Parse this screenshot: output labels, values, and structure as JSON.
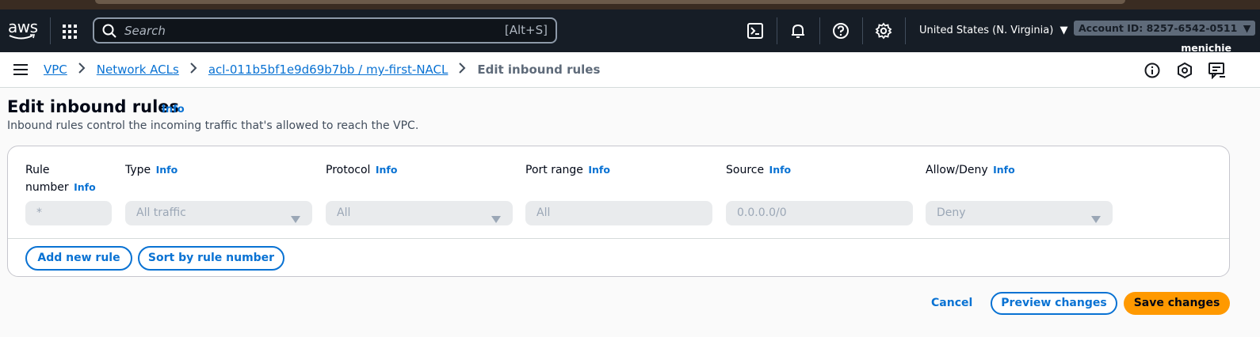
{
  "header": {
    "logo_text": "aws",
    "search_placeholder": "Search",
    "search_shortcut": "[Alt+S]",
    "region": "United States (N. Virginia)",
    "account": "Account ID: 8257-6542-0511",
    "user": "menichie"
  },
  "breadcrumb": {
    "items": [
      "VPC",
      "Network ACLs",
      "acl-011b5bf1e9d69b7bb / my-first-NACL"
    ],
    "current": "Edit inbound rules"
  },
  "page": {
    "title": "Edit inbound rules",
    "info": "Info",
    "description": "Inbound rules control the incoming traffic that's allowed to reach the VPC."
  },
  "rules": {
    "columns": {
      "rule_number_line1": "Rule",
      "rule_number_line2": "number",
      "type": "Type",
      "protocol": "Protocol",
      "port_range": "Port range",
      "source": "Source",
      "allow_deny": "Allow/Deny"
    },
    "row": {
      "rule_number_placeholder": "*",
      "type": "All traffic",
      "protocol": "All",
      "port_range": "All",
      "source": "0.0.0.0/0",
      "allow_deny": "Deny"
    },
    "add_rule_label": "Add new rule",
    "sort_label": "Sort by rule number"
  },
  "footer": {
    "cancel": "Cancel",
    "preview": "Preview changes",
    "save": "Save changes"
  },
  "colors": {
    "nav_bg": "#161d26",
    "link": "#0972d3",
    "primary": "#ff9900"
  },
  "icons": [
    "grid-icon",
    "search-icon",
    "cloudshell-icon",
    "bell-icon",
    "help-icon",
    "settings-icon",
    "menu-icon",
    "info-icon",
    "security-icon",
    "feedback-icon",
    "chevron-right-icon",
    "caret-down-icon"
  ]
}
